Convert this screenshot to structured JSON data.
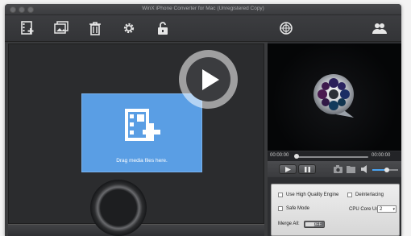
{
  "window": {
    "title": "WinX iPhone Converter for Mac (Unregistered Copy)"
  },
  "toolbar": {
    "buttons": [
      {
        "name": "add-video-icon"
      },
      {
        "name": "add-photo-icon"
      },
      {
        "name": "trash-icon"
      },
      {
        "name": "gear-icon"
      },
      {
        "name": "unlock-icon"
      },
      {
        "name": "update-globe-icon"
      },
      {
        "name": "users-icon"
      }
    ]
  },
  "main": {
    "drop_text": "Drag media files here."
  },
  "player": {
    "time_current": "00:00:00",
    "time_total": "00:00:00",
    "volume_level": 0.55,
    "seek_progress": 0.0
  },
  "settings": {
    "high_quality_label": "Use High Quality Engine",
    "deinterlacing_label": "Deinterlacing",
    "safe_mode_label": "Safe Mode",
    "cpu_core_label": "CPU Core Use:",
    "cpu_core_value": "2",
    "merge_all_label": "Merge All:",
    "merge_all_state": "OFF"
  },
  "colors": {
    "accent_blue": "#5a9ee4",
    "window_bg": "#3a3b3d",
    "panel_bg": "#2b2c2e"
  }
}
